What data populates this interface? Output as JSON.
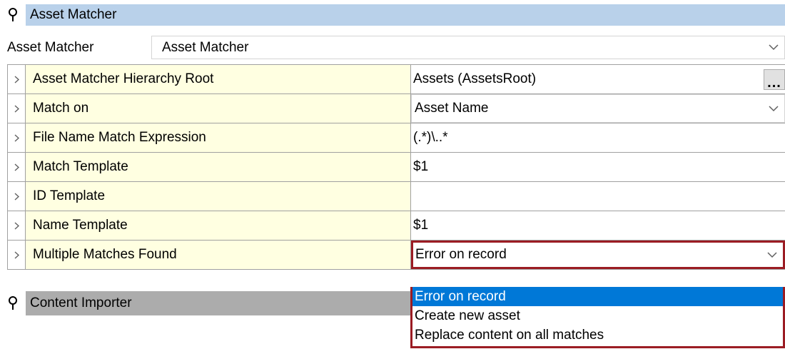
{
  "sections": {
    "asset_matcher": "Asset Matcher",
    "content_importer": "Content Importer"
  },
  "matcher_select": {
    "label": "Asset Matcher",
    "value": "Asset Matcher"
  },
  "properties": [
    {
      "name": "Asset Matcher Hierarchy Root",
      "value": "Assets (AssetsRoot)"
    },
    {
      "name": "Match on",
      "value": "Asset Name"
    },
    {
      "name": "File Name Match Expression",
      "value": "(.*)\\..*"
    },
    {
      "name": "Match Template",
      "value": "$1"
    },
    {
      "name": "ID Template",
      "value": ""
    },
    {
      "name": "Name Template",
      "value": "$1"
    },
    {
      "name": "Multiple Matches Found",
      "value": "Error on record"
    }
  ],
  "ellipsis_label": "...",
  "dropdown_options": [
    {
      "label": "Error on record",
      "selected": true
    },
    {
      "label": "Create new asset",
      "selected": false
    },
    {
      "label": "Replace content on all matches",
      "selected": false
    }
  ],
  "colors": {
    "section_active": "#b9d1ea",
    "section_inactive": "#acacac",
    "property_name_bg": "#ffffe1",
    "focus_border": "#9b1c23",
    "selection": "#0078d7"
  },
  "icons": {
    "pin": "pin-icon",
    "expand": "chevron-right-icon",
    "dropdown": "chevron-down-icon"
  }
}
